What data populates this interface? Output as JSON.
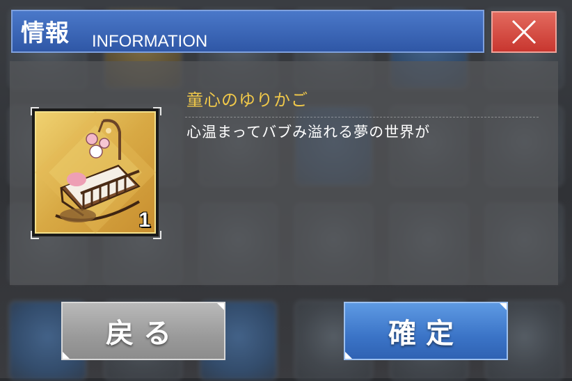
{
  "header": {
    "title_jp": "情報",
    "title_en": "INFORMATION",
    "close_icon": "close-icon"
  },
  "item": {
    "name": "童心のゆりかご",
    "description": "心温まってバブみ溢れる夢の世界が",
    "count": "1",
    "icon": "cradle-icon"
  },
  "buttons": {
    "back_label": "戻る",
    "confirm_label": "確定"
  },
  "colors": {
    "header_blue": "#2f57a6",
    "close_red": "#c8362f",
    "item_name_gold": "#f0c84a",
    "confirm_blue": "#3b74c7",
    "back_gray": "#9a9a9a"
  }
}
